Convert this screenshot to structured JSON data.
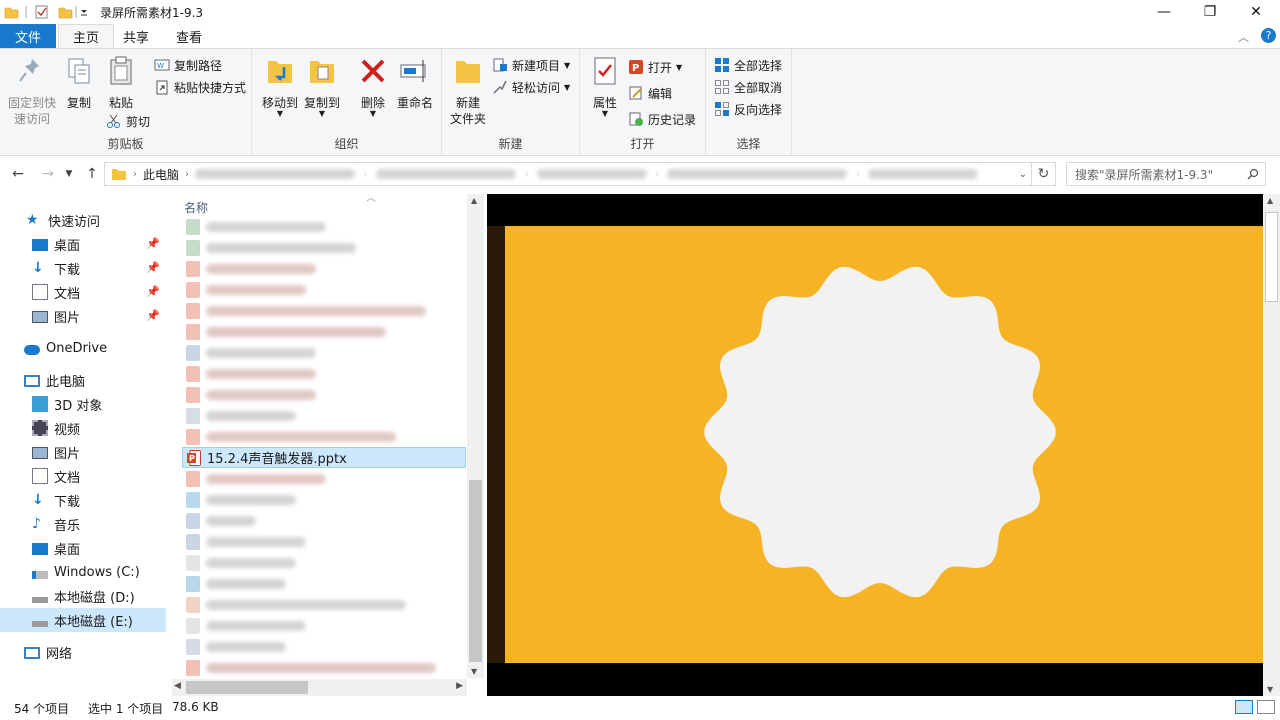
{
  "window": {
    "title": "录屏所需素材1-9.3",
    "minimize": "—",
    "maximize": "❐",
    "close": "✕"
  },
  "ribbon_tabs": [
    "文件",
    "主页",
    "共享",
    "查看"
  ],
  "ribbon": {
    "clipboard": {
      "label": "剪贴板",
      "pin_quick": "固定到快速访问",
      "pin_quick_l1": "固定到快",
      "pin_quick_l2": "速访问",
      "copy": "复制",
      "paste": "粘贴",
      "copy_path": "复制路径",
      "paste_shortcut": "粘贴快捷方式",
      "cut": "剪切"
    },
    "organize": {
      "label": "组织",
      "move_to": "移动到",
      "copy_to": "复制到",
      "delete": "删除",
      "rename": "重命名"
    },
    "new": {
      "label": "新建",
      "new_folder_l1": "新建",
      "new_folder_l2": "文件夹",
      "new_item": "新建项目",
      "easy_access": "轻松访问"
    },
    "open": {
      "label": "打开",
      "properties": "属性",
      "open": "打开",
      "edit": "编辑",
      "history": "历史记录"
    },
    "select": {
      "label": "选择",
      "select_all": "全部选择",
      "select_none": "全部取消",
      "invert": "反向选择"
    }
  },
  "address": {
    "root": "此电脑",
    "search_placeholder": "搜索\"录屏所需素材1-9.3\""
  },
  "nav": {
    "quick_access": "快速访问",
    "quick_items": [
      "桌面",
      "下载",
      "文档",
      "图片"
    ],
    "onedrive": "OneDrive",
    "this_pc": "此电脑",
    "pc_items": [
      "3D 对象",
      "视频",
      "图片",
      "文档",
      "下载",
      "音乐",
      "桌面",
      "Windows (C:)",
      "本地磁盘 (D:)",
      "本地磁盘 (E:)"
    ],
    "network": "网络"
  },
  "files": {
    "column_name": "名称",
    "selected_file": "15.2.4声音触发器.pptx"
  },
  "preview": {
    "bg_color": "#f5b325",
    "shape_color": "#f2f2f2"
  },
  "status": {
    "count": "54 个项目",
    "selection": "选中 1 个项目",
    "size": "78.6 KB"
  }
}
